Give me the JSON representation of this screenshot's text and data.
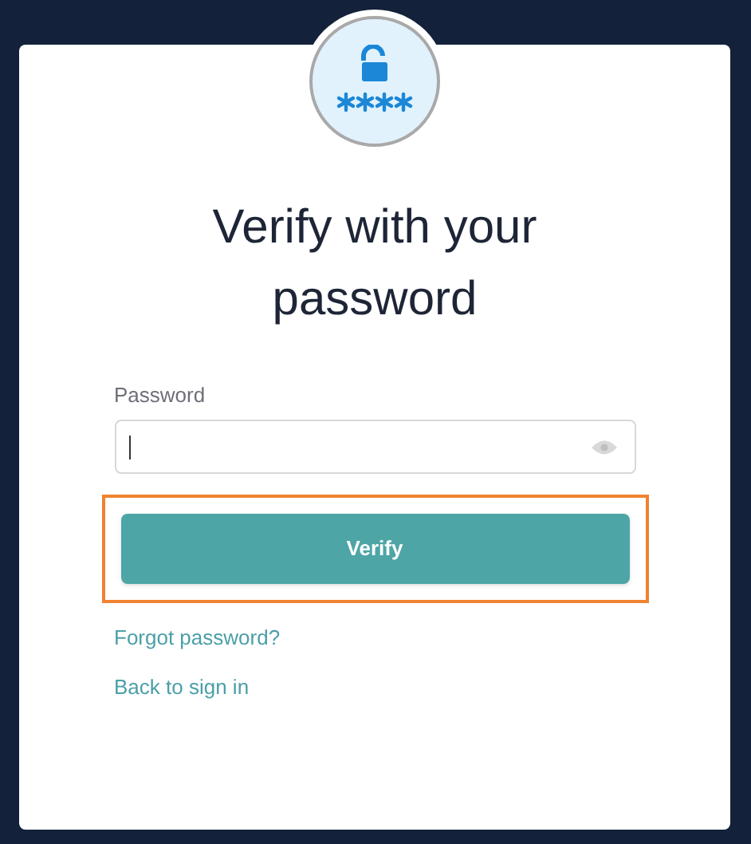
{
  "title": "Verify with your password",
  "password_field": {
    "label": "Password"
  },
  "verify_button": {
    "label": "Verify",
    "highlighted": true
  },
  "links": [
    "Forgot password?",
    "Back to sign in"
  ]
}
